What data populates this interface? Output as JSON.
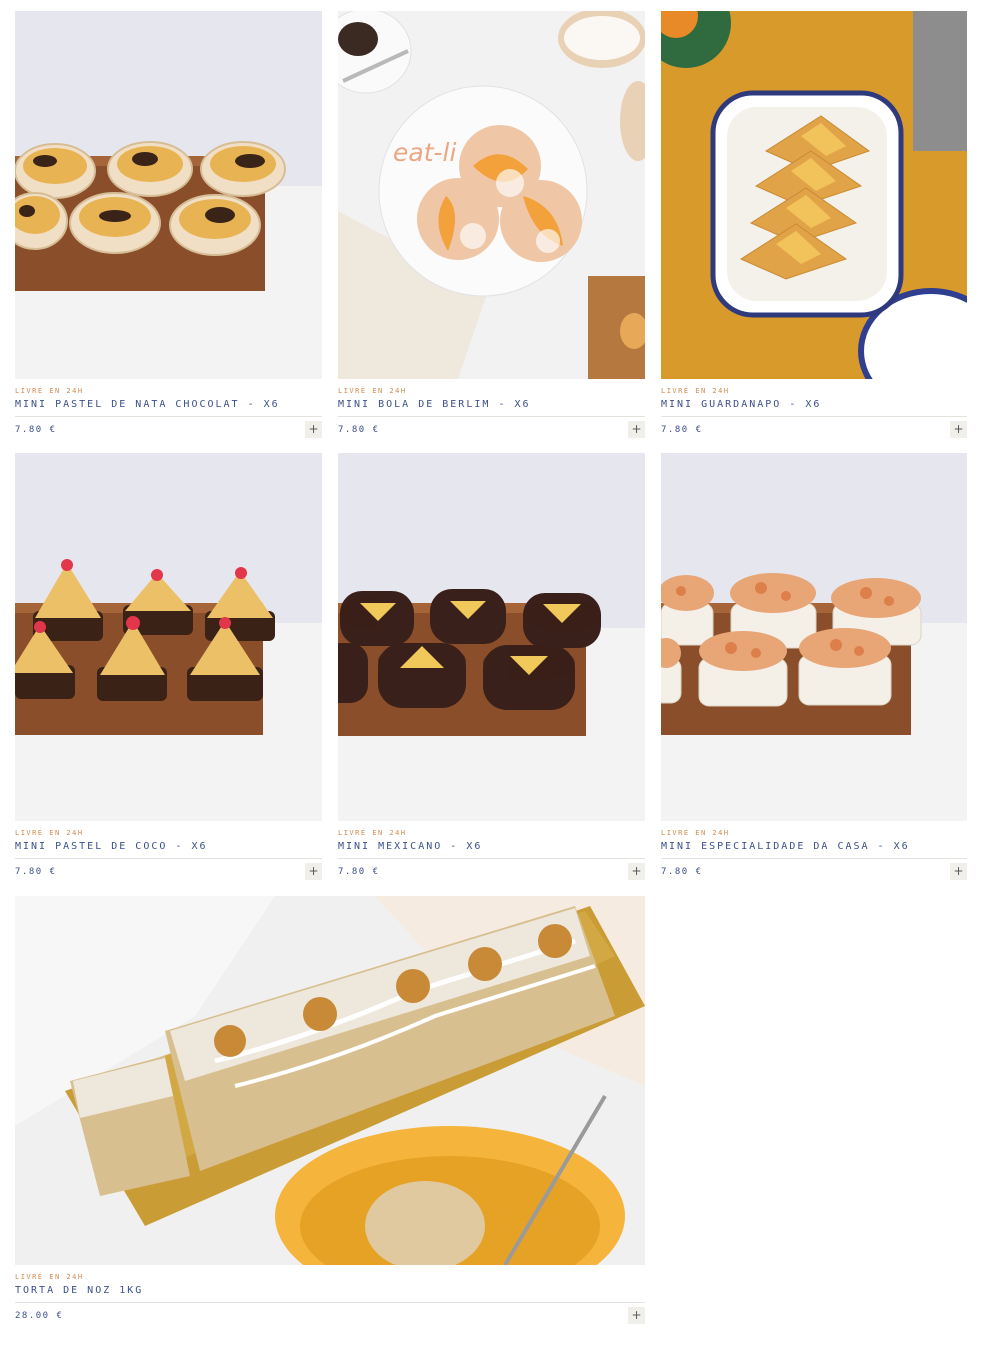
{
  "products": [
    {
      "badge": "LIVRÉ EN 24H",
      "name": "MINI PASTEL DE NATA CHOCOLAT - X6",
      "price": "7.80 €",
      "add_label": "+",
      "photo": "pastel-de-nata-chocolat"
    },
    {
      "badge": "LIVRÉ EN 24H",
      "name": "MINI BOLA DE BERLIM - X6",
      "price": "7.80 €",
      "add_label": "+",
      "photo": "bola-de-berlim",
      "watermark": "eat-li"
    },
    {
      "badge": "LIVRÉ EN 24H",
      "name": "MINI GUARDANAPO - X6",
      "price": "7.80 €",
      "add_label": "+",
      "photo": "guardanapo"
    },
    {
      "badge": "LIVRÉ EN 24H",
      "name": "MINI PASTEL DE COCO - X6",
      "price": "7.80 €",
      "add_label": "+",
      "photo": "pastel-de-coco"
    },
    {
      "badge": "LIVRÉ EN 24H",
      "name": "MINI MEXICANO - X6",
      "price": "7.80 €",
      "add_label": "+",
      "photo": "mexicano"
    },
    {
      "badge": "LIVRÉ EN 24H",
      "name": "MINI ESPECIALIDADE DA CASA - X6",
      "price": "7.80 €",
      "add_label": "+",
      "photo": "especialidade-da-casa"
    },
    {
      "badge": "LIVRÉ EN 24H",
      "name": "TORTA DE NOZ 1KG",
      "price": "28.00 €",
      "add_label": "+",
      "photo": "torta-de-noz"
    }
  ],
  "colors": {
    "accent_badge": "#d08a50",
    "text_navy": "#3c4f8a",
    "button_bg": "#f1efe9"
  }
}
